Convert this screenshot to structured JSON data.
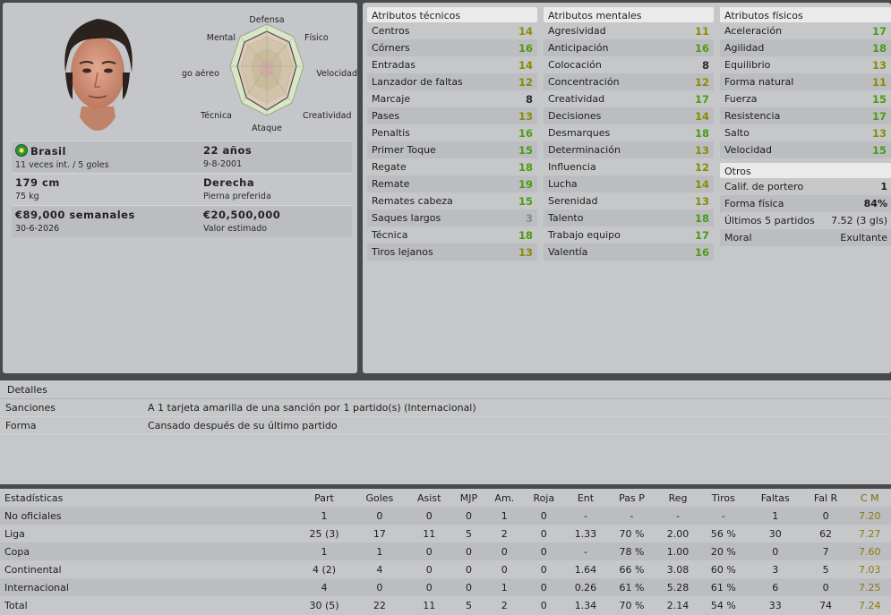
{
  "profile": {
    "radar_labels": {
      "top": "Defensa",
      "top_left": "Mental",
      "top_right": "Físico",
      "left": "go aéreo",
      "right": "Velocidad",
      "bottom_left": "Técnica",
      "bottom_right": "Creatividad",
      "bottom": "Ataque"
    },
    "nationality": "Brasil",
    "caps": "11 veces int. / 5 goles",
    "age": "22 años",
    "birthdate": "9-8-2001",
    "height": "179 cm",
    "weight": "75 kg",
    "foot": "Derecha",
    "foot_label": "Pierna preferida",
    "wage": "€89,000 semanales",
    "contract_end": "30-6-2026",
    "value": "€20,500,000",
    "value_label": "Valor estimado"
  },
  "technical": {
    "title": "Atributos técnicos",
    "items": [
      {
        "label": "Centros",
        "value": "14"
      },
      {
        "label": "Córners",
        "value": "16"
      },
      {
        "label": "Entradas",
        "value": "14"
      },
      {
        "label": "Lanzador de faltas",
        "value": "12"
      },
      {
        "label": "Marcaje",
        "value": "8"
      },
      {
        "label": "Pases",
        "value": "13"
      },
      {
        "label": "Penaltis",
        "value": "16"
      },
      {
        "label": "Primer Toque",
        "value": "15"
      },
      {
        "label": "Regate",
        "value": "18"
      },
      {
        "label": "Remate",
        "value": "19"
      },
      {
        "label": "Remates cabeza",
        "value": "15"
      },
      {
        "label": "Saques largos",
        "value": "3"
      },
      {
        "label": "Técnica",
        "value": "18"
      },
      {
        "label": "Tiros lejanos",
        "value": "13"
      }
    ]
  },
  "mental": {
    "title": "Atributos mentales",
    "items": [
      {
        "label": "Agresividad",
        "value": "11"
      },
      {
        "label": "Anticipación",
        "value": "16"
      },
      {
        "label": "Colocación",
        "value": "8"
      },
      {
        "label": "Concentración",
        "value": "12"
      },
      {
        "label": "Creatividad",
        "value": "17"
      },
      {
        "label": "Decisiones",
        "value": "14"
      },
      {
        "label": "Desmarques",
        "value": "18"
      },
      {
        "label": "Determinación",
        "value": "13"
      },
      {
        "label": "Influencia",
        "value": "12"
      },
      {
        "label": "Lucha",
        "value": "14"
      },
      {
        "label": "Serenidad",
        "value": "13"
      },
      {
        "label": "Talento",
        "value": "18"
      },
      {
        "label": "Trabajo equipo",
        "value": "17"
      },
      {
        "label": "Valentía",
        "value": "16"
      }
    ]
  },
  "physical": {
    "title": "Atributos físicos",
    "items": [
      {
        "label": "Aceleración",
        "value": "17"
      },
      {
        "label": "Agilidad",
        "value": "18"
      },
      {
        "label": "Equilibrio",
        "value": "13"
      },
      {
        "label": "Forma natural",
        "value": "11"
      },
      {
        "label": "Fuerza",
        "value": "15"
      },
      {
        "label": "Resistencia",
        "value": "17"
      },
      {
        "label": "Salto",
        "value": "13"
      },
      {
        "label": "Velocidad",
        "value": "15"
      }
    ]
  },
  "otros": {
    "title": "Otros",
    "items": [
      {
        "label": "Calif. de portero",
        "value": "1"
      },
      {
        "label": "Forma física",
        "value": "84%"
      },
      {
        "label": "Últimos 5 partidos",
        "value": "7.52 (3 gls)"
      },
      {
        "label": "Moral",
        "value": "Exultante"
      }
    ]
  },
  "detalles": {
    "title": "Detalles",
    "rows": [
      {
        "label": "Sanciones",
        "value": "A 1 tarjeta amarilla de una sanción por 1 partido(s) (Internacional)"
      },
      {
        "label": "Forma",
        "value": "Cansado después de su último partido"
      }
    ]
  },
  "stats": {
    "headers": [
      "Estadísticas",
      "Part",
      "Goles",
      "Asist",
      "MJP",
      "Am.",
      "Roja",
      "Ent",
      "Pas P",
      "Reg",
      "Tiros",
      "Faltas",
      "Fal R",
      "C M"
    ],
    "rows": [
      [
        "No oficiales",
        "1",
        "0",
        "0",
        "0",
        "1",
        "0",
        "-",
        "-",
        "-",
        "-",
        "1",
        "0",
        "7.20"
      ],
      [
        "Liga",
        "25 (3)",
        "17",
        "11",
        "5",
        "2",
        "0",
        "1.33",
        "70 %",
        "2.00",
        "56 %",
        "30",
        "62",
        "7.27"
      ],
      [
        "Copa",
        "1",
        "1",
        "0",
        "0",
        "0",
        "0",
        "-",
        "78 %",
        "1.00",
        "20 %",
        "0",
        "7",
        "7.60"
      ],
      [
        "Continental",
        "4 (2)",
        "4",
        "0",
        "0",
        "0",
        "0",
        "1.64",
        "66 %",
        "3.08",
        "60 %",
        "3",
        "5",
        "7.03"
      ],
      [
        "Internacional",
        "4",
        "0",
        "0",
        "0",
        "1",
        "0",
        "0.26",
        "61 %",
        "5.28",
        "61 %",
        "6",
        "0",
        "7.25"
      ],
      [
        "Total",
        "30 (5)",
        "22",
        "11",
        "5",
        "2",
        "0",
        "1.34",
        "70 %",
        "2.14",
        "54 %",
        "33",
        "74",
        "7.24"
      ]
    ]
  }
}
